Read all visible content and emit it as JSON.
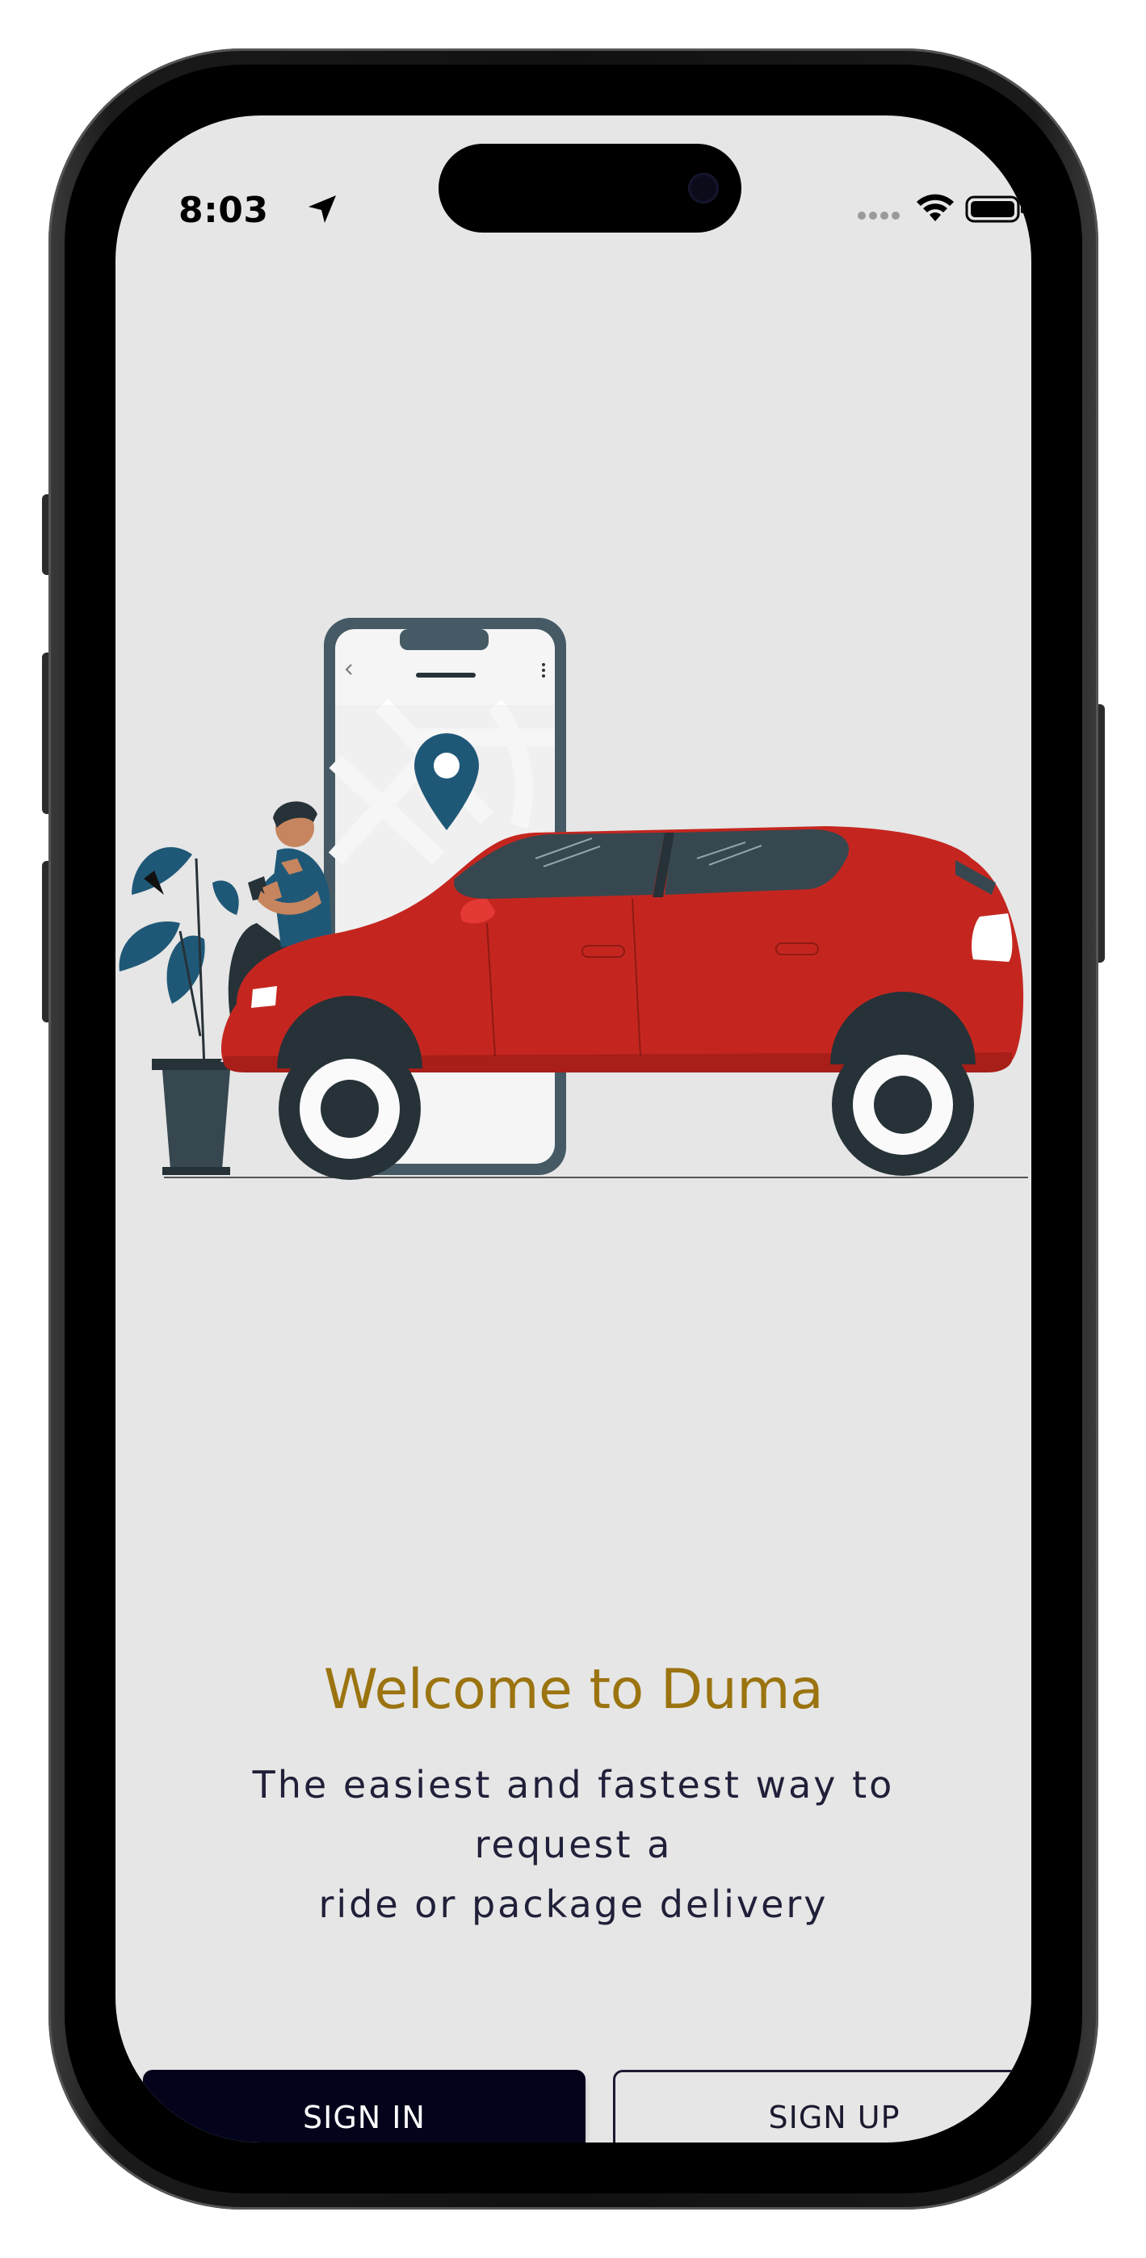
{
  "status_bar": {
    "time": "8:03"
  },
  "welcome": {
    "title": "Welcome to Duma",
    "subtitle_line1": "The easiest and fastest way to request a",
    "subtitle_line2": "ride or package delivery"
  },
  "actions": {
    "sign_in_label": "SIGN IN",
    "sign_up_label": "SIGN UP"
  },
  "colors": {
    "screen_bg": "#e6e6e6",
    "title": "#9b7410",
    "primary_button": "#03031c",
    "car_body": "#c4261f",
    "pin": "#1f5877"
  },
  "icons": [
    "location-arrow-icon",
    "cellular-signal-icon",
    "wifi-icon",
    "battery-icon"
  ]
}
